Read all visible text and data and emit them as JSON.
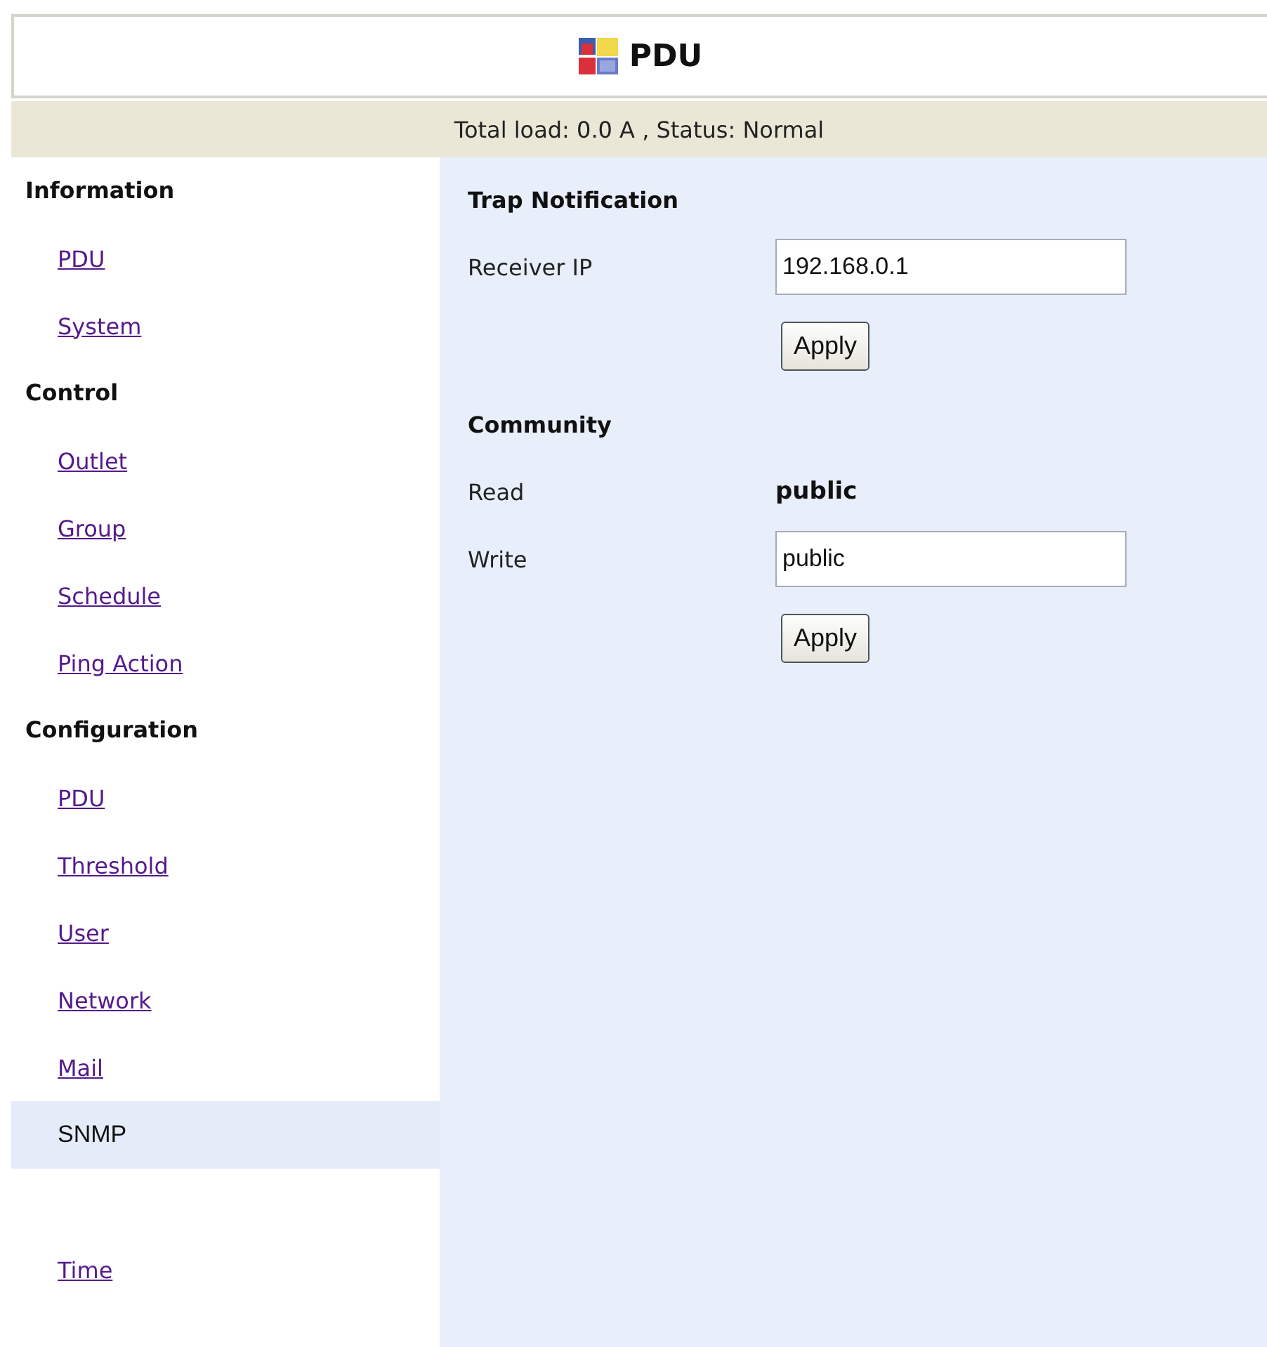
{
  "header": {
    "title": "PDU"
  },
  "status_bar": {
    "text": "Total load: 0.0 A , Status: Normal"
  },
  "sidebar": {
    "sections": [
      {
        "title": "Information",
        "items": [
          {
            "label": "PDU",
            "selected": false
          },
          {
            "label": "System",
            "selected": false
          }
        ]
      },
      {
        "title": "Control",
        "items": [
          {
            "label": "Outlet",
            "selected": false
          },
          {
            "label": "Group",
            "selected": false
          },
          {
            "label": "Schedule",
            "selected": false
          },
          {
            "label": "Ping Action",
            "selected": false
          }
        ]
      },
      {
        "title": "Configuration",
        "items": [
          {
            "label": "PDU",
            "selected": false
          },
          {
            "label": "Threshold",
            "selected": false
          },
          {
            "label": "User",
            "selected": false
          },
          {
            "label": "Network",
            "selected": false
          },
          {
            "label": "Mail",
            "selected": false
          },
          {
            "label": "SNMP",
            "selected": true
          },
          {
            "label": "Time",
            "selected": false
          }
        ]
      }
    ]
  },
  "sections": [
    {
      "title": "Trap Notification",
      "fields": [
        {
          "kind": "input",
          "label": "Receiver IP",
          "value": "192.168.0.1"
        }
      ],
      "button": "Apply"
    },
    {
      "title": "Community",
      "fields": [
        {
          "kind": "text",
          "label": "Read",
          "value": "public"
        },
        {
          "kind": "input",
          "label": "Write",
          "value": "public"
        }
      ],
      "button": "Apply"
    }
  ]
}
